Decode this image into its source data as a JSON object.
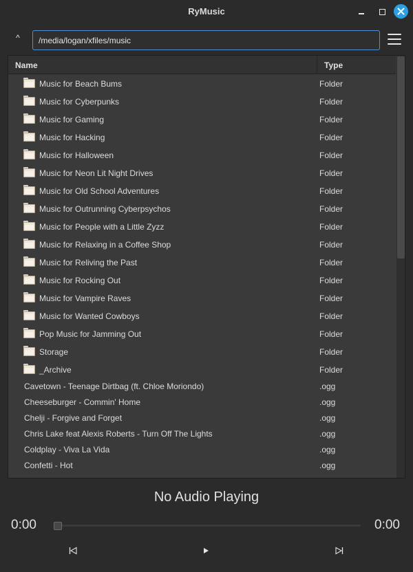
{
  "window": {
    "title": "RyMusic"
  },
  "toolbar": {
    "up_glyph": "^",
    "path_value": "/media/logan/xfiles/music"
  },
  "columns": {
    "name": "Name",
    "type": "Type"
  },
  "rows": [
    {
      "name": "Music for Beach Bums",
      "type": "Folder",
      "kind": "folder"
    },
    {
      "name": "Music for Cyberpunks",
      "type": "Folder",
      "kind": "folder"
    },
    {
      "name": "Music for Gaming",
      "type": "Folder",
      "kind": "folder"
    },
    {
      "name": "Music for Hacking",
      "type": "Folder",
      "kind": "folder"
    },
    {
      "name": "Music for Halloween",
      "type": "Folder",
      "kind": "folder"
    },
    {
      "name": "Music for Neon Lit Night Drives",
      "type": "Folder",
      "kind": "folder"
    },
    {
      "name": "Music for Old School Adventures",
      "type": "Folder",
      "kind": "folder"
    },
    {
      "name": "Music for Outrunning Cyberpsychos",
      "type": "Folder",
      "kind": "folder"
    },
    {
      "name": "Music for People with a Little Zyzz",
      "type": "Folder",
      "kind": "folder"
    },
    {
      "name": "Music for Relaxing in a Coffee Shop",
      "type": "Folder",
      "kind": "folder"
    },
    {
      "name": "Music for Reliving the Past",
      "type": "Folder",
      "kind": "folder"
    },
    {
      "name": "Music for Rocking Out",
      "type": "Folder",
      "kind": "folder"
    },
    {
      "name": "Music for Vampire Raves",
      "type": "Folder",
      "kind": "folder"
    },
    {
      "name": "Music for Wanted Cowboys",
      "type": "Folder",
      "kind": "folder"
    },
    {
      "name": "Pop Music for Jamming Out",
      "type": "Folder",
      "kind": "folder"
    },
    {
      "name": "Storage",
      "type": "Folder",
      "kind": "folder"
    },
    {
      "name": "_Archive",
      "type": "Folder",
      "kind": "folder"
    },
    {
      "name": "Cavetown - Teenage Dirtbag (ft. Chloe Moriondo)",
      "type": ".ogg",
      "kind": "file"
    },
    {
      "name": "Cheeseburger - Commin' Home",
      "type": ".ogg",
      "kind": "file"
    },
    {
      "name": "Chelji - Forgive and Forget",
      "type": ".ogg",
      "kind": "file"
    },
    {
      "name": "Chris Lake feat Alexis Roberts - Turn Off The Lights",
      "type": ".ogg",
      "kind": "file"
    },
    {
      "name": "Coldplay - Viva La Vida",
      "type": ".ogg",
      "kind": "file"
    },
    {
      "name": "Confetti - Hot",
      "type": ".ogg",
      "kind": "file"
    }
  ],
  "player": {
    "status": "No Audio Playing",
    "current_time": "0:00",
    "total_time": "0:00",
    "progress": 0
  },
  "icons": {
    "minimize": "minimize-icon",
    "maximize": "maximize-icon",
    "close": "close-icon",
    "up": "up-arrow-icon",
    "menu": "hamburger-menu-icon",
    "folder": "folder-icon",
    "prev": "skip-previous-icon",
    "play": "play-icon",
    "next": "skip-next-icon"
  },
  "colors": {
    "accent": "#2e9ee3",
    "input_border": "#5090d8",
    "background": "#2b2b2b",
    "list_bg": "#3a3a3a"
  }
}
